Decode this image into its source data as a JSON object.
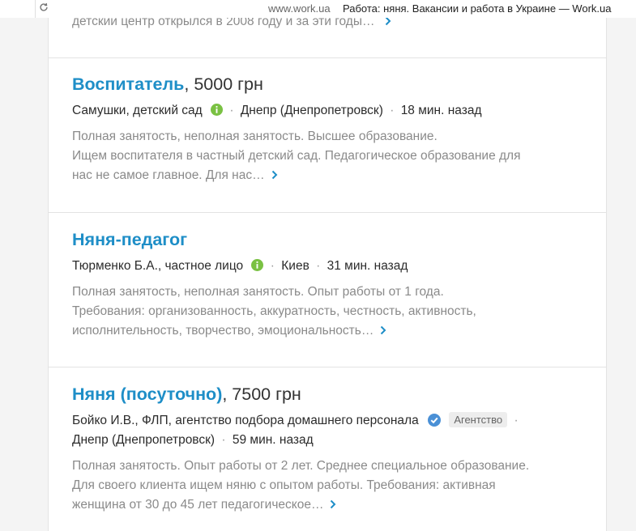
{
  "browser": {
    "domain": "www.work.ua",
    "tab_title": "Работа: няня. Вакансии и работа в Украине — Work.ua"
  },
  "previous_snippet": "детский центр открылся в 2008 году и за эти годы…",
  "colors": {
    "title_link": "#1e8ec7",
    "info_icon": "#7ac143",
    "verified_icon": "#4a90d6"
  },
  "jobs": [
    {
      "title": "Воспитатель",
      "salary": ", 5000 грн",
      "company": "Самушки, детский сад",
      "icon": "info-icon",
      "location": "Днепр (Днепропетровск)",
      "posted": "18 мин. назад",
      "desc": [
        "Полная занятость, неполная занятость. Высшее образование.",
        "Ищем воспитателя в частный детский сад. Педагогическое образование для",
        "нас не самое главное. Для нас…"
      ]
    },
    {
      "title": "Няня-педагог",
      "salary": "",
      "company": "Тюрменко Б.А., частное лицо",
      "icon": "info-icon",
      "location": "Киев",
      "posted": "31 мин. назад",
      "desc": [
        "Полная занятость, неполная занятость. Опыт работы от 1 года.",
        "Требования: организованность, аккуратность, честность, активность,",
        "исполнительность, творчество, эмоциональность…"
      ]
    },
    {
      "title": "Няня (посуточно)",
      "salary": ", 7500 грн",
      "company": "Бойко И.В., ФЛП, агентство подбора домашнего персонала",
      "icon": "verified-icon",
      "badge": "Агентство",
      "location": "Днепр (Днепропетровск)",
      "posted": "59 мин. назад",
      "desc": [
        "Полная занятость. Опыт работы от 2 лет. Среднее специальное образование.",
        "Для своего клиента ищем няню с опытом работы. Требования: активная",
        "женщина от 30 до 45 лет педагогическое…"
      ]
    }
  ]
}
